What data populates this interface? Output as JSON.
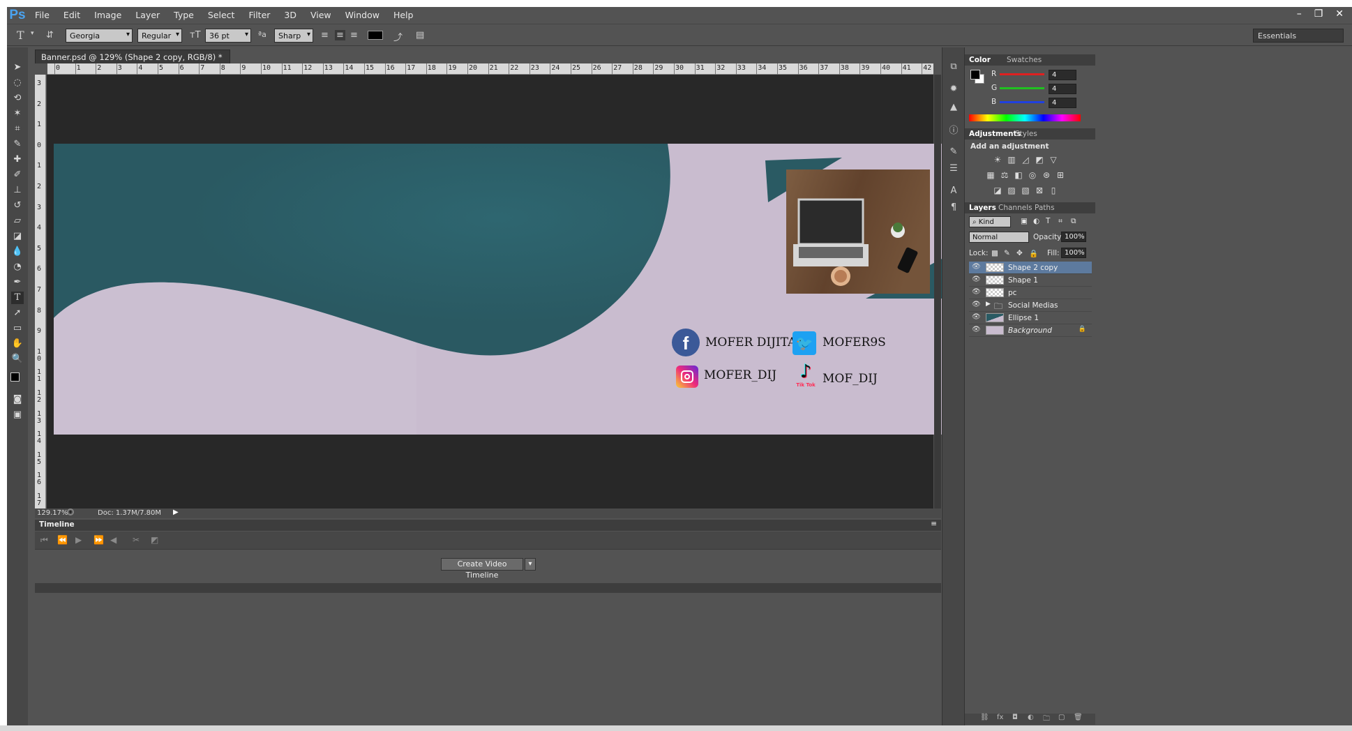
{
  "app": {
    "logo": "Ps"
  },
  "menu": [
    "File",
    "Edit",
    "Image",
    "Layer",
    "Type",
    "Select",
    "Filter",
    "3D",
    "View",
    "Window",
    "Help"
  ],
  "window_controls": {
    "minimize": "–",
    "restore": "❐",
    "close": "✕"
  },
  "options": {
    "tool_icon": "T",
    "font_family": "Georgia",
    "font_style": "Regular",
    "font_size": "36 pt",
    "aa_label": "ªa",
    "antialias": "Sharp",
    "workspace": "Essentials",
    "text_color": "#000000"
  },
  "document": {
    "tab_title": "Banner.psd @ 129% (Shape 2 copy, RGB/8) *",
    "tab_close": "×",
    "zoom": "129.17%",
    "doc_size": "Doc: 1.37M/7.80M"
  },
  "rulers": {
    "horizontal": [
      "0",
      "1",
      "2",
      "3",
      "4",
      "5",
      "6",
      "7",
      "8",
      "9",
      "10",
      "11",
      "12",
      "13",
      "14",
      "15",
      "16",
      "17",
      "18",
      "19",
      "20",
      "21",
      "22",
      "23",
      "24",
      "25",
      "26",
      "27",
      "28",
      "29",
      "30",
      "31",
      "32",
      "33",
      "34",
      "35",
      "36",
      "37",
      "38",
      "39",
      "40",
      "41",
      "42"
    ],
    "vertical": [
      "3",
      "2",
      "1",
      "0",
      "1",
      "2",
      "3",
      "4",
      "5",
      "6",
      "7",
      "8",
      "9",
      "1\n0",
      "1\n1",
      "1\n2",
      "1\n3",
      "1\n4",
      "1\n5",
      "1\n6",
      "1\n7"
    ]
  },
  "banner": {
    "background": "#c9bccf",
    "accent": "#2a5a63",
    "socials": [
      {
        "handle": "MOFER DIJITAL",
        "icon": "facebook-icon"
      },
      {
        "handle": "MOFER9S",
        "icon": "twitter-icon"
      },
      {
        "handle": "MOFER_DIJ",
        "icon": "instagram-icon"
      },
      {
        "handle": "MOF_DIJ",
        "icon": "tiktok-icon",
        "caption": "Tik Tok"
      }
    ]
  },
  "timeline": {
    "title": "Timeline",
    "create_button": "Create Video Timeline"
  },
  "color_panel": {
    "tabs": [
      "Color",
      "Swatches"
    ],
    "channels": [
      {
        "label": "R",
        "value": "4",
        "color": "#e02020"
      },
      {
        "label": "G",
        "value": "4",
        "color": "#20c020"
      },
      {
        "label": "B",
        "value": "4",
        "color": "#2040e0"
      }
    ]
  },
  "adjustments_panel": {
    "tabs": [
      "Adjustments",
      "Styles"
    ],
    "heading": "Add an adjustment"
  },
  "layers_panel": {
    "tabs": [
      "Layers",
      "Channels",
      "Paths"
    ],
    "filter": "Kind",
    "blend_mode": "Normal",
    "opacity_label": "Opacity:",
    "opacity": "100%",
    "lock_label": "Lock:",
    "fill_label": "Fill:",
    "fill": "100%",
    "layers": [
      {
        "name": "Shape 2 copy",
        "selected": true
      },
      {
        "name": "Shape 1",
        "selected": false
      },
      {
        "name": "pc",
        "selected": false
      },
      {
        "name": "Social Medias",
        "selected": false,
        "group": true
      },
      {
        "name": "Ellipse 1",
        "selected": false
      },
      {
        "name": "Background",
        "selected": false,
        "locked": true
      }
    ]
  }
}
